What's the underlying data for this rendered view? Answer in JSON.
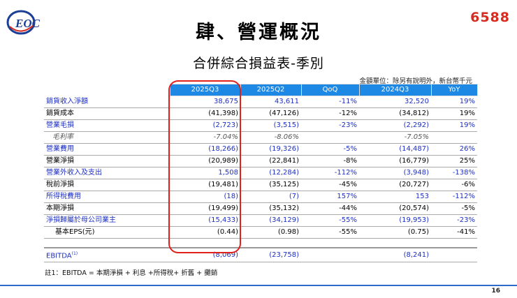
{
  "header": {
    "logo_text": "EOC",
    "ticker": "6588",
    "title": "肆、營運概況",
    "subtitle": "合併綜合損益表-季別",
    "unit_note": "金額單位：除另有說明外，新台幣千元"
  },
  "table": {
    "columns": [
      "2025Q3",
      "2025Q2",
      "QoQ",
      "2024Q3",
      "YoY"
    ],
    "rows": [
      {
        "label": "銷貨收入淨額",
        "values": [
          "38,675",
          "43,611",
          "-11%",
          "32,520",
          "19%"
        ]
      },
      {
        "label": "銷貨成本",
        "values": [
          "(41,398)",
          "(47,126)",
          "-12%",
          "(34,812)",
          "19%"
        ]
      },
      {
        "label": "營業毛損",
        "values": [
          "(2,723)",
          "(3,515)",
          "-23%",
          "(2,292)",
          "19%"
        ]
      },
      {
        "label": "毛利率",
        "values": [
          "-7.04%",
          "-8.06%",
          "",
          "-7.05%",
          ""
        ]
      },
      {
        "label": "營業費用",
        "values": [
          "(18,266)",
          "(19,326)",
          "-5%",
          "(14,487)",
          "26%"
        ]
      },
      {
        "label": "營業淨損",
        "values": [
          "(20,989)",
          "(22,841)",
          "-8%",
          "(16,779)",
          "25%"
        ]
      },
      {
        "label": "營業外收入及支出",
        "values": [
          "1,508",
          "(12,284)",
          "-112%",
          "(3,948)",
          "-138%"
        ]
      },
      {
        "label": "稅前淨損",
        "values": [
          "(19,481)",
          "(35,125)",
          "-45%",
          "(20,727)",
          "-6%"
        ]
      },
      {
        "label": "所得稅費用",
        "values": [
          "(18)",
          "(7)",
          "157%",
          "153",
          "-112%"
        ]
      },
      {
        "label": "本期淨損",
        "values": [
          "(19,499)",
          "(35,132)",
          "-44%",
          "(20,574)",
          "-5%"
        ]
      },
      {
        "label": "淨損歸屬於母公司業主",
        "values": [
          "(15,433)",
          "(34,129)",
          "-55%",
          "(19,953)",
          "-23%"
        ]
      },
      {
        "label": "基本EPS(元)",
        "values": [
          "(0.44)",
          "(0.98)",
          "-55%",
          "(0.75)",
          "-41%"
        ]
      }
    ],
    "ebitda": {
      "label": "EBITDA",
      "sup": "(1)",
      "values": [
        "(8,069)",
        "(23,758)",
        "",
        "(8,241)",
        ""
      ]
    }
  },
  "footnote": "註1：EBITDA = 本期淨損 + 利息 +所得稅+ 折舊 + 攤銷",
  "page_number": "16",
  "colors": {
    "header_blue": "#1e88e5",
    "highlight_red": "#e0201a",
    "ticker_red": "#d62b1f",
    "label_blue": "#1d2fc4"
  }
}
